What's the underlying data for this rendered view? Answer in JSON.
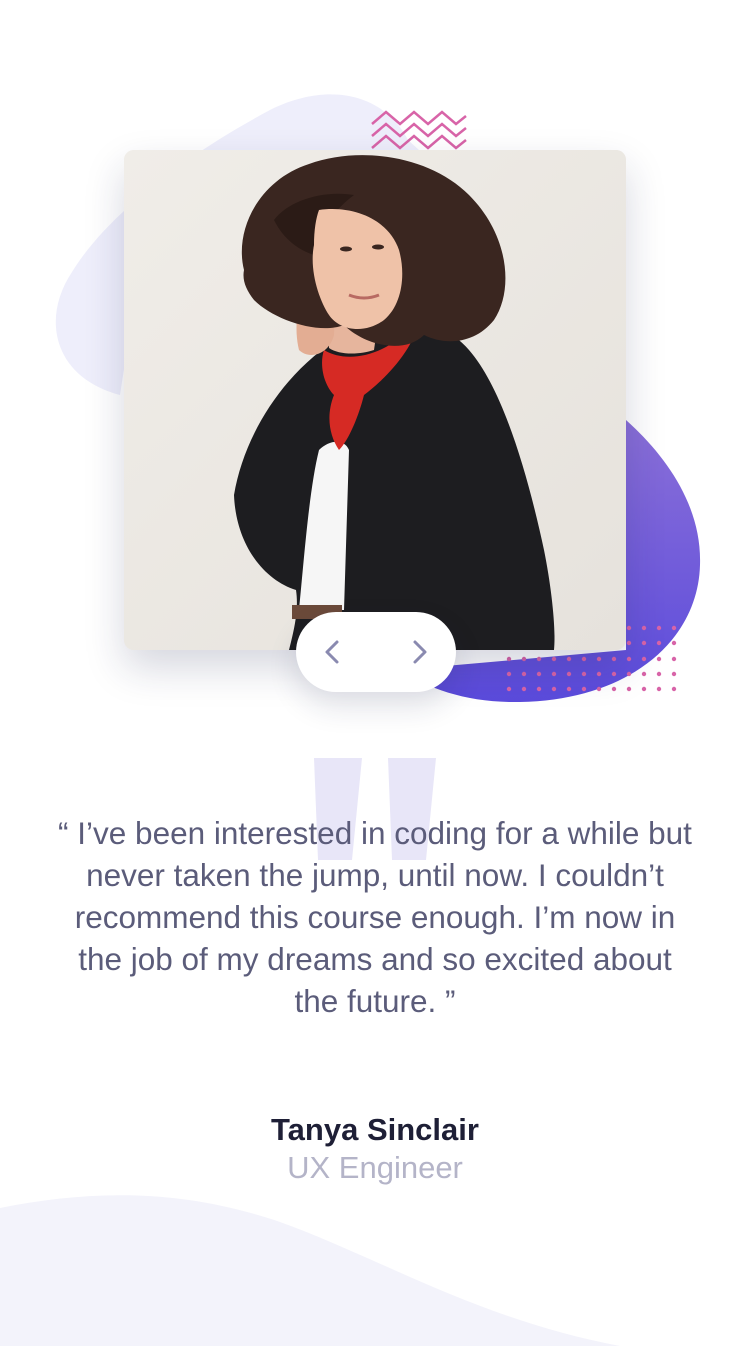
{
  "testimonial": {
    "quote": "“ I’ve been interested in coding for a while but never taken the jump, until now. I couldn’t recommend this course enough. I’m now in the job of my dreams and so excited about the future. ”",
    "name": "Tanya Sinclair",
    "role": "UX Engineer"
  },
  "nav": {
    "prev_icon": "chevron-left-icon",
    "next_icon": "chevron-right-icon"
  },
  "colors": {
    "name": "#1e1f36",
    "quote": "#5b5c7a",
    "role": "#b4b4c8",
    "blob_light": "#eeeefb",
    "purple_start": "#8a6fd8",
    "purple_end": "#5b4bdc",
    "pink_accent": "#d864a8",
    "nav_arrow": "#8a8ab0"
  }
}
